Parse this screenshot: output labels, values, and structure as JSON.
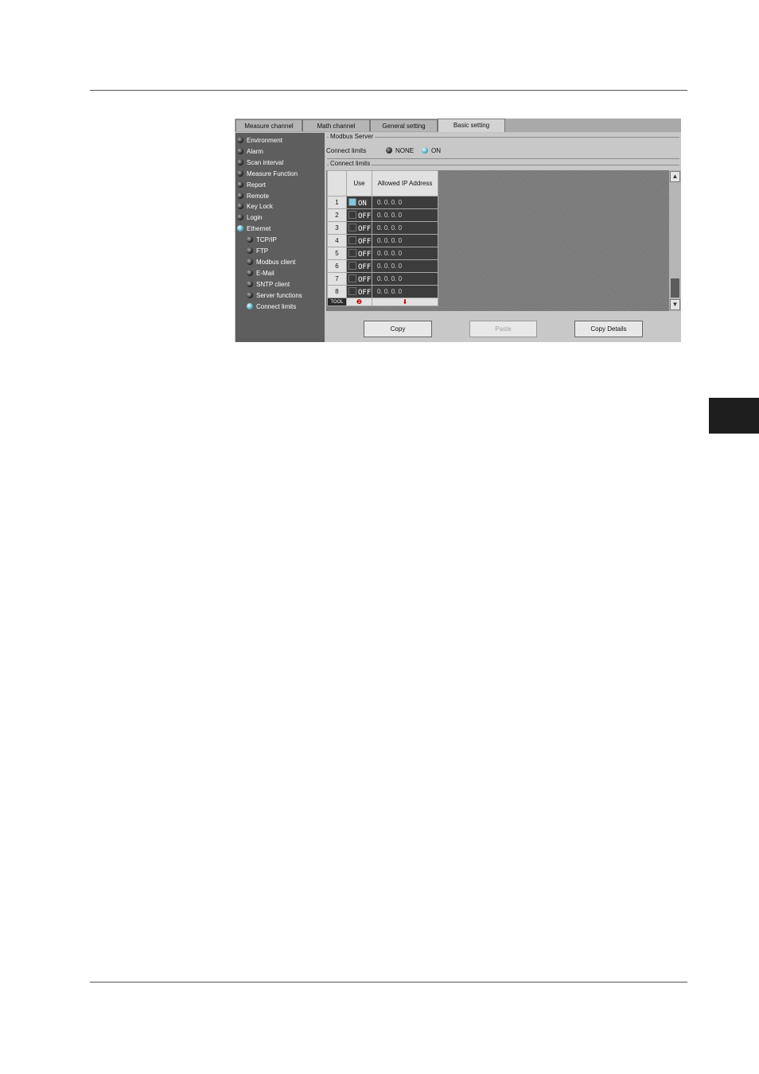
{
  "tabs": [
    "Measure channel",
    "Math channel",
    "General setting",
    "Basic setting"
  ],
  "active_tab": "Basic setting",
  "sidebar": {
    "items": [
      {
        "label": "Environment",
        "level": 0,
        "selected": false
      },
      {
        "label": "Alarm",
        "level": 0,
        "selected": false
      },
      {
        "label": "Scan interval",
        "level": 0,
        "selected": false
      },
      {
        "label": "Measure Function",
        "level": 0,
        "selected": false
      },
      {
        "label": "Report",
        "level": 0,
        "selected": false
      },
      {
        "label": "Remote",
        "level": 0,
        "selected": false
      },
      {
        "label": "Key Lock",
        "level": 0,
        "selected": false
      },
      {
        "label": "Login",
        "level": 0,
        "selected": false
      },
      {
        "label": "Ethernet",
        "level": 0,
        "selected": true
      },
      {
        "label": "TCP/IP",
        "level": 1,
        "selected": false
      },
      {
        "label": "FTP",
        "level": 1,
        "selected": false
      },
      {
        "label": "Modbus client",
        "level": 1,
        "selected": false
      },
      {
        "label": "E-Mail",
        "level": 1,
        "selected": false
      },
      {
        "label": "SNTP client",
        "level": 1,
        "selected": false
      },
      {
        "label": "Server functions",
        "level": 1,
        "selected": false
      },
      {
        "label": "Connect limits",
        "level": 1,
        "selected": true
      }
    ]
  },
  "modbus": {
    "group_title": "Modbus Server",
    "field_label": "Connect limits",
    "options": [
      "NONE",
      "ON"
    ],
    "selected": "ON"
  },
  "limits": {
    "group_title": "Connect limits",
    "columns": [
      "Use",
      "Allowed IP Address"
    ],
    "rows": [
      {
        "num": "1",
        "use": "ON",
        "address": "0. 0. 0. 0"
      },
      {
        "num": "2",
        "use": "OFF",
        "address": "0. 0. 0. 0"
      },
      {
        "num": "3",
        "use": "OFF",
        "address": "0. 0. 0. 0"
      },
      {
        "num": "4",
        "use": "OFF",
        "address": "0. 0. 0. 0"
      },
      {
        "num": "5",
        "use": "OFF",
        "address": "0. 0. 0. 0"
      },
      {
        "num": "6",
        "use": "OFF",
        "address": "0. 0. 0. 0"
      },
      {
        "num": "7",
        "use": "OFF",
        "address": "0. 0. 0. 0"
      },
      {
        "num": "8",
        "use": "OFF",
        "address": "0. 0. 0. 0"
      }
    ],
    "footer_toggle": "TOOL",
    "footer_marks": [
      "❷",
      "⬇"
    ]
  },
  "buttons": {
    "copy": "Copy",
    "paste": "Paste",
    "copy_details": "Copy Details"
  },
  "scrollbar": {
    "up_icon": "▲",
    "down_icon": "▼"
  },
  "colors": {
    "accent": "#3d9fb6",
    "sidebar_bg": "#5e5e5e",
    "cell_bg": "#3c3c3c"
  }
}
